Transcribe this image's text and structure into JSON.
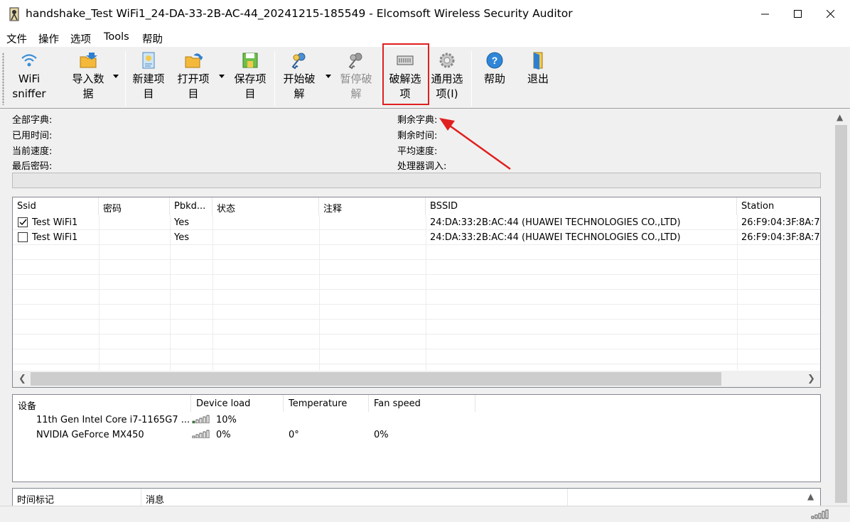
{
  "window": {
    "title": "handshake_Test WiFi1_24-DA-33-2B-AC-44_20241215-185549 - Elcomsoft Wireless Security Auditor"
  },
  "menu": [
    "文件",
    "操作",
    "选项",
    "Tools",
    "帮助"
  ],
  "toolbar": {
    "wifi_sniffer": [
      "WiFi",
      "sniffer"
    ],
    "import_data": [
      "导入数",
      "据"
    ],
    "new_project": [
      "新建项",
      "目"
    ],
    "open_project": [
      "打开项",
      "目"
    ],
    "save_project": [
      "保存项",
      "目"
    ],
    "start_attack": [
      "开始破",
      "解"
    ],
    "pause_attack": [
      "暂停破",
      "解"
    ],
    "attack_options": [
      "破解选",
      "项"
    ],
    "general_options": [
      "通用选",
      "项(I)"
    ],
    "help": "帮助",
    "exit": "退出"
  },
  "stats": {
    "total_dict": "全部字典:",
    "elapsed": "已用时间:",
    "current_speed": "当前速度:",
    "last_password": "最后密码:",
    "remaining_dict": "剩余字典:",
    "remaining_time": "剩余时间:",
    "avg_speed": "平均速度:",
    "cpu_throttle": "处理器调入:"
  },
  "networks": {
    "columns": [
      "Ssid",
      "密码",
      "Pbkd...",
      "状态",
      "注释",
      "BSSID",
      "Station"
    ],
    "rows": [
      {
        "checked": true,
        "ssid": "Test WiFi1",
        "password": "",
        "pbkdf": "Yes",
        "status": "",
        "comment": "",
        "bssid": "24:DA:33:2B:AC:44 (HUAWEI TECHNOLOGIES CO.,LTD)",
        "station": "26:F9:04:3F:8A:7"
      },
      {
        "checked": false,
        "ssid": "Test WiFi1",
        "password": "",
        "pbkdf": "Yes",
        "status": "",
        "comment": "",
        "bssid": "24:DA:33:2B:AC:44 (HUAWEI TECHNOLOGIES CO.,LTD)",
        "station": "26:F9:04:3F:8A:7"
      }
    ]
  },
  "devices": {
    "columns": [
      "设备",
      "Device load",
      "Temperature",
      "Fan speed"
    ],
    "rows": [
      {
        "name": "11th Gen Intel Core i7-1165G7 ...",
        "load": "10%",
        "load_level": 0.2,
        "temperature": "",
        "fan": ""
      },
      {
        "name": "NVIDIA GeForce MX450",
        "load": "0%",
        "load_level": 0,
        "temperature": "0°",
        "fan": "0%"
      }
    ]
  },
  "log": {
    "columns": [
      "时间标记",
      "消息"
    ]
  },
  "colors": {
    "accent_highlight": "#e02020",
    "load_bar_on": "#2db32d"
  }
}
